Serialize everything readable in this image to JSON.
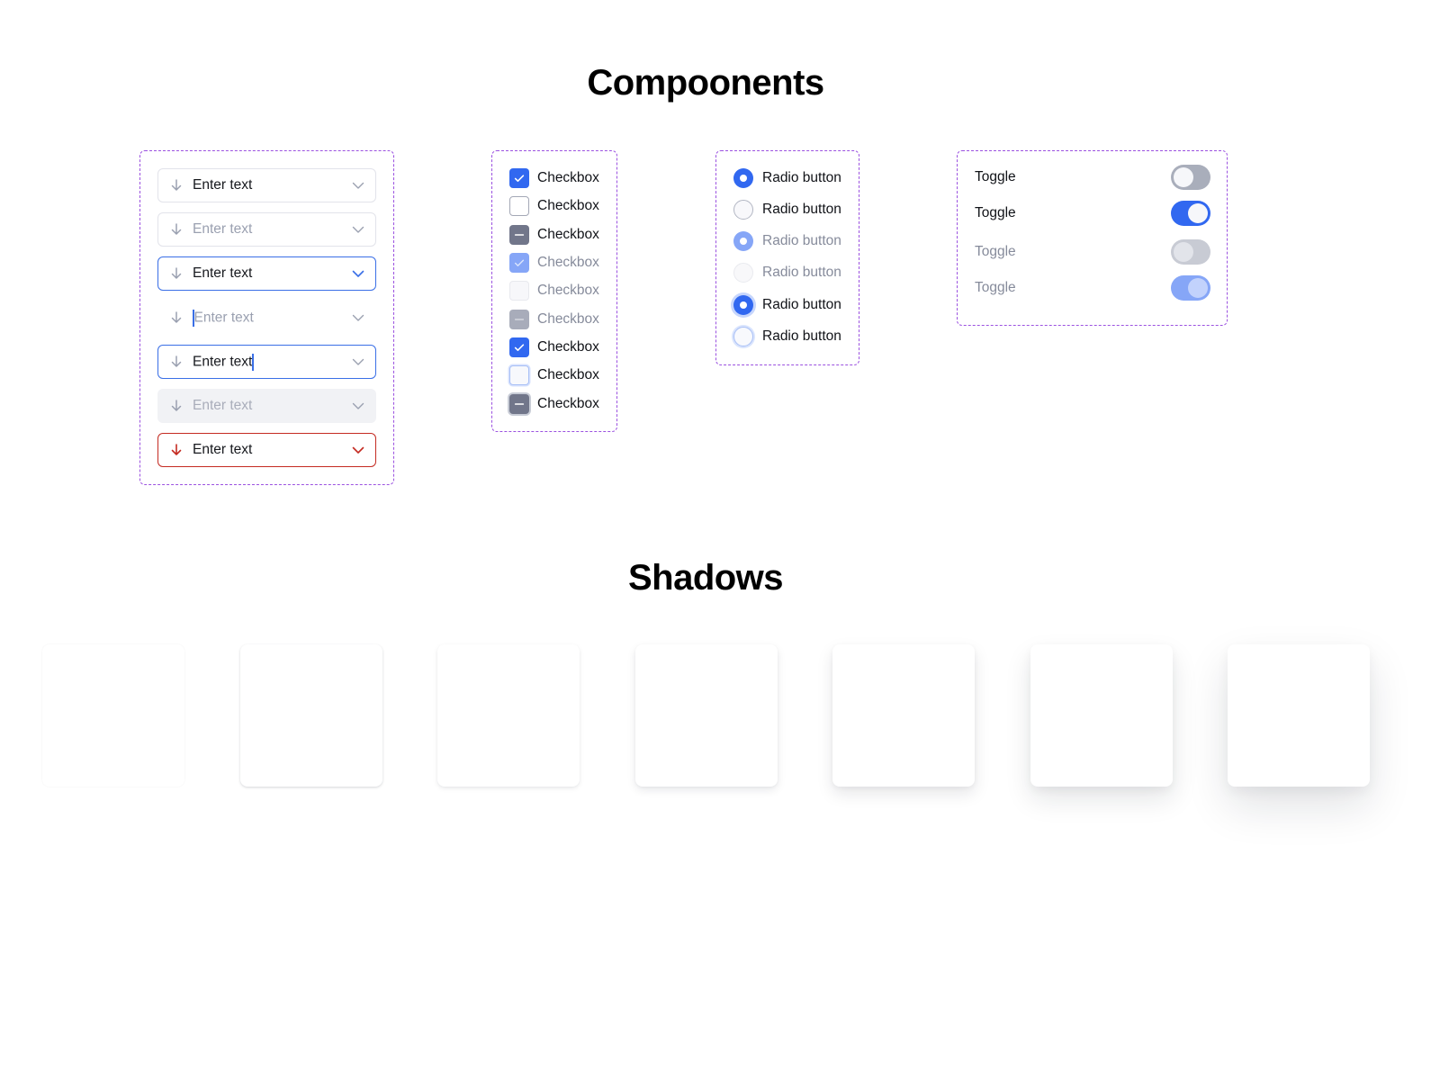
{
  "sections": {
    "components_title": "Compoonents",
    "shadows_title": "Shadows"
  },
  "colors": {
    "accent": "#3168f0",
    "error": "#c42b22",
    "group_border": "#9b51e0"
  },
  "inputs": [
    {
      "state": "default",
      "value": "Enter text",
      "leading_icon": "arrow-down-icon",
      "trailing_icon": "chevron-down-icon"
    },
    {
      "state": "placeholder",
      "placeholder": "Enter text",
      "leading_icon": "arrow-down-icon",
      "trailing_icon": "chevron-down-icon"
    },
    {
      "state": "focused",
      "value": "Enter text",
      "leading_icon": "arrow-down-icon",
      "trailing_icon": "chevron-down-icon"
    },
    {
      "state": "borderless-typing",
      "placeholder": "Enter text",
      "leading_icon": "arrow-down-icon",
      "trailing_icon": "chevron-down-icon"
    },
    {
      "state": "focused-typing",
      "value": "Enter text",
      "leading_icon": "arrow-down-icon",
      "trailing_icon": "chevron-down-icon"
    },
    {
      "state": "disabled",
      "placeholder": "Enter text",
      "leading_icon": "arrow-down-icon",
      "trailing_icon": "chevron-down-icon"
    },
    {
      "state": "error",
      "value": "Enter text",
      "leading_icon": "arrow-down-icon",
      "trailing_icon": "chevron-down-icon"
    }
  ],
  "checkboxes": [
    {
      "label": "Checkbox",
      "state": "checked"
    },
    {
      "label": "Checkbox",
      "state": "unchecked"
    },
    {
      "label": "Checkbox",
      "state": "indeterminate"
    },
    {
      "label": "Checkbox",
      "state": "checked-disabled"
    },
    {
      "label": "Checkbox",
      "state": "unchecked-disabled"
    },
    {
      "label": "Checkbox",
      "state": "indeterminate-disabled"
    },
    {
      "label": "Checkbox",
      "state": "checked"
    },
    {
      "label": "Checkbox",
      "state": "unchecked-focused"
    },
    {
      "label": "Checkbox",
      "state": "indeterminate-focused"
    }
  ],
  "radios": [
    {
      "label": "Radio button",
      "state": "selected"
    },
    {
      "label": "Radio button",
      "state": "unselected"
    },
    {
      "label": "Radio button",
      "state": "selected-disabled"
    },
    {
      "label": "Radio button",
      "state": "unselected-disabled"
    },
    {
      "label": "Radio button",
      "state": "selected-focused"
    },
    {
      "label": "Radio button",
      "state": "unselected-focused"
    }
  ],
  "toggles": [
    {
      "label": "Toggle",
      "state": "off"
    },
    {
      "label": "Toggle",
      "state": "on"
    },
    {
      "label": "Toggle",
      "state": "off-disabled"
    },
    {
      "label": "Toggle",
      "state": "on-disabled"
    }
  ],
  "shadow_cards": [
    {
      "level": 1
    },
    {
      "level": 2
    },
    {
      "level": 3
    },
    {
      "level": 4
    },
    {
      "level": 5
    },
    {
      "level": 6
    },
    {
      "level": 7
    }
  ]
}
